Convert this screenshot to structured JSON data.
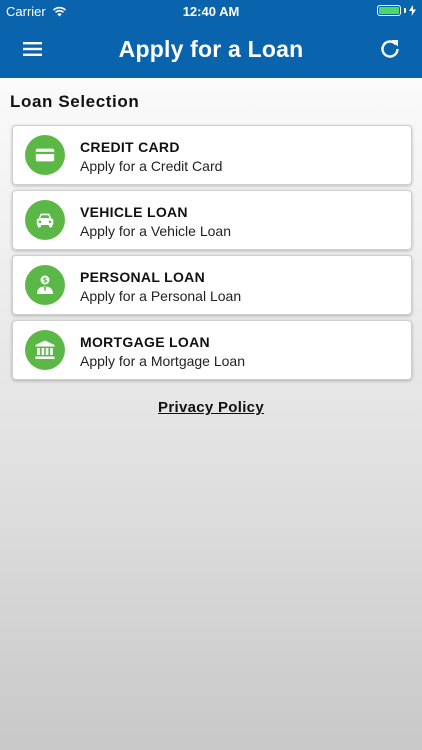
{
  "status_bar": {
    "carrier": "Carrier",
    "time": "12:40 AM",
    "battery_color": "#4cd964"
  },
  "nav": {
    "title": "Apply for a Loan",
    "left_icon": "menu-icon",
    "right_icon": "refresh-icon",
    "background": "#0a64ad"
  },
  "section_title": "Loan Selection",
  "accent_color": "#5cb846",
  "loans": [
    {
      "title": "CREDIT CARD",
      "subtitle": "Apply for a Credit Card",
      "icon": "credit-card-icon"
    },
    {
      "title": "VEHICLE LOAN",
      "subtitle": "Apply for a Vehicle Loan",
      "icon": "car-icon"
    },
    {
      "title": "PERSONAL LOAN",
      "subtitle": "Apply for a Personal Loan",
      "icon": "person-dollar-icon"
    },
    {
      "title": "MORTGAGE LOAN",
      "subtitle": "Apply for a Mortgage Loan",
      "icon": "bank-icon"
    }
  ],
  "privacy_link": "Privacy Policy"
}
